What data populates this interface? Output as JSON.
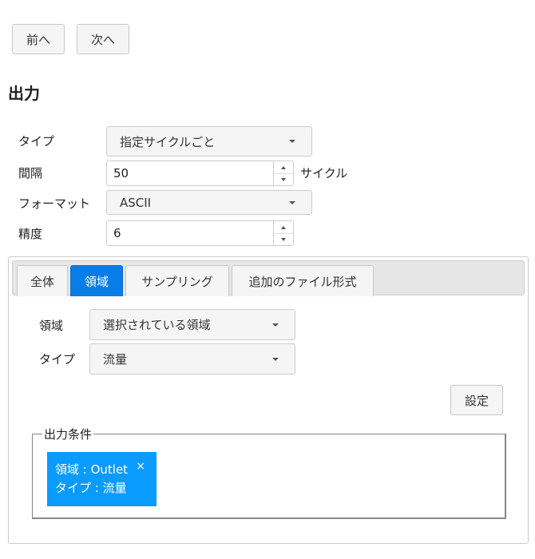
{
  "nav": {
    "prev_label": "前へ",
    "next_label": "次へ"
  },
  "output": {
    "heading": "出力",
    "type_label": "タイプ",
    "type_value": "指定サイクルごと",
    "interval_label": "間隔",
    "interval_value": "50",
    "interval_unit": "サイクル",
    "format_label": "フォーマット",
    "format_value": "ASCII",
    "precision_label": "精度",
    "precision_value": "6"
  },
  "tabs": [
    {
      "label": "全体",
      "active": false
    },
    {
      "label": "領域",
      "active": true
    },
    {
      "label": "サンプリング",
      "active": false
    },
    {
      "label": "追加のファイル形式",
      "active": false
    }
  ],
  "region_tab": {
    "region_label": "領域",
    "region_value": "選択されている領域",
    "type_label": "タイプ",
    "type_value": "流量",
    "set_button": "設定",
    "conditions_legend": "出力条件",
    "condition": {
      "line1": "領域 : Outlet",
      "line2": "タイプ : 流量",
      "close": "×"
    }
  },
  "colors": {
    "accent": "#0a7ce6",
    "chip": "#0a9bff"
  }
}
